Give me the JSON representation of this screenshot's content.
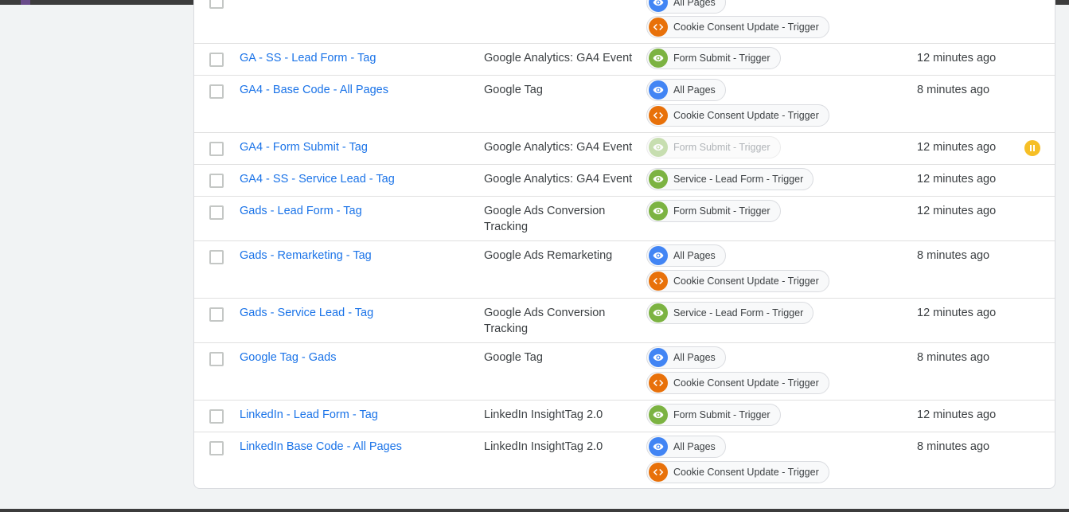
{
  "chip_labels": {
    "all_pages": "All Pages",
    "cookie": "Cookie Consent Update - Trigger",
    "form_submit": "Form Submit - Trigger",
    "service_lead": "Service - Lead Form - Trigger"
  },
  "rows": [
    {
      "name": "",
      "type": "",
      "time": ""
    },
    {
      "name": "GA - SS - Lead Form - Tag",
      "type": "Google Analytics: GA4 Event",
      "time": "12 minutes ago"
    },
    {
      "name": "GA4 - Base Code - All Pages",
      "type": "Google Tag",
      "time": "8 minutes ago"
    },
    {
      "name": "GA4 - Form Submit - Tag",
      "type": "Google Analytics: GA4 Event",
      "time": "12 minutes ago",
      "status": "paused"
    },
    {
      "name": "GA4 - SS - Service Lead - Tag",
      "type": "Google Analytics: GA4 Event",
      "time": "12 minutes ago"
    },
    {
      "name": "Gads - Lead Form - Tag",
      "type": "Google Ads Conversion Tracking",
      "time": "12 minutes ago"
    },
    {
      "name": "Gads - Remarketing - Tag",
      "type": "Google Ads Remarketing",
      "time": "8 minutes ago"
    },
    {
      "name": "Gads - Service Lead - Tag",
      "type": "Google Ads Conversion Tracking",
      "time": "12 minutes ago"
    },
    {
      "name": "Google Tag - Gads",
      "type": "Google Tag",
      "time": "8 minutes ago"
    },
    {
      "name": "LinkedIn - Lead Form - Tag",
      "type": "LinkedIn InsightTag 2.0",
      "time": "12 minutes ago"
    },
    {
      "name": "LinkedIn Base Code - All Pages",
      "type": "LinkedIn InsightTag 2.0",
      "time": "8 minutes ago"
    }
  ],
  "colors": {
    "link": "#1a73e8",
    "pageview_trigger": "#4285f4",
    "custom_event_trigger": "#e8710a",
    "form_trigger": "#7cb342",
    "paused": "#f6bf26"
  },
  "icons": {
    "pageview": "eye-icon",
    "custom_event": "code-brackets-icon",
    "paused": "pause-icon"
  }
}
